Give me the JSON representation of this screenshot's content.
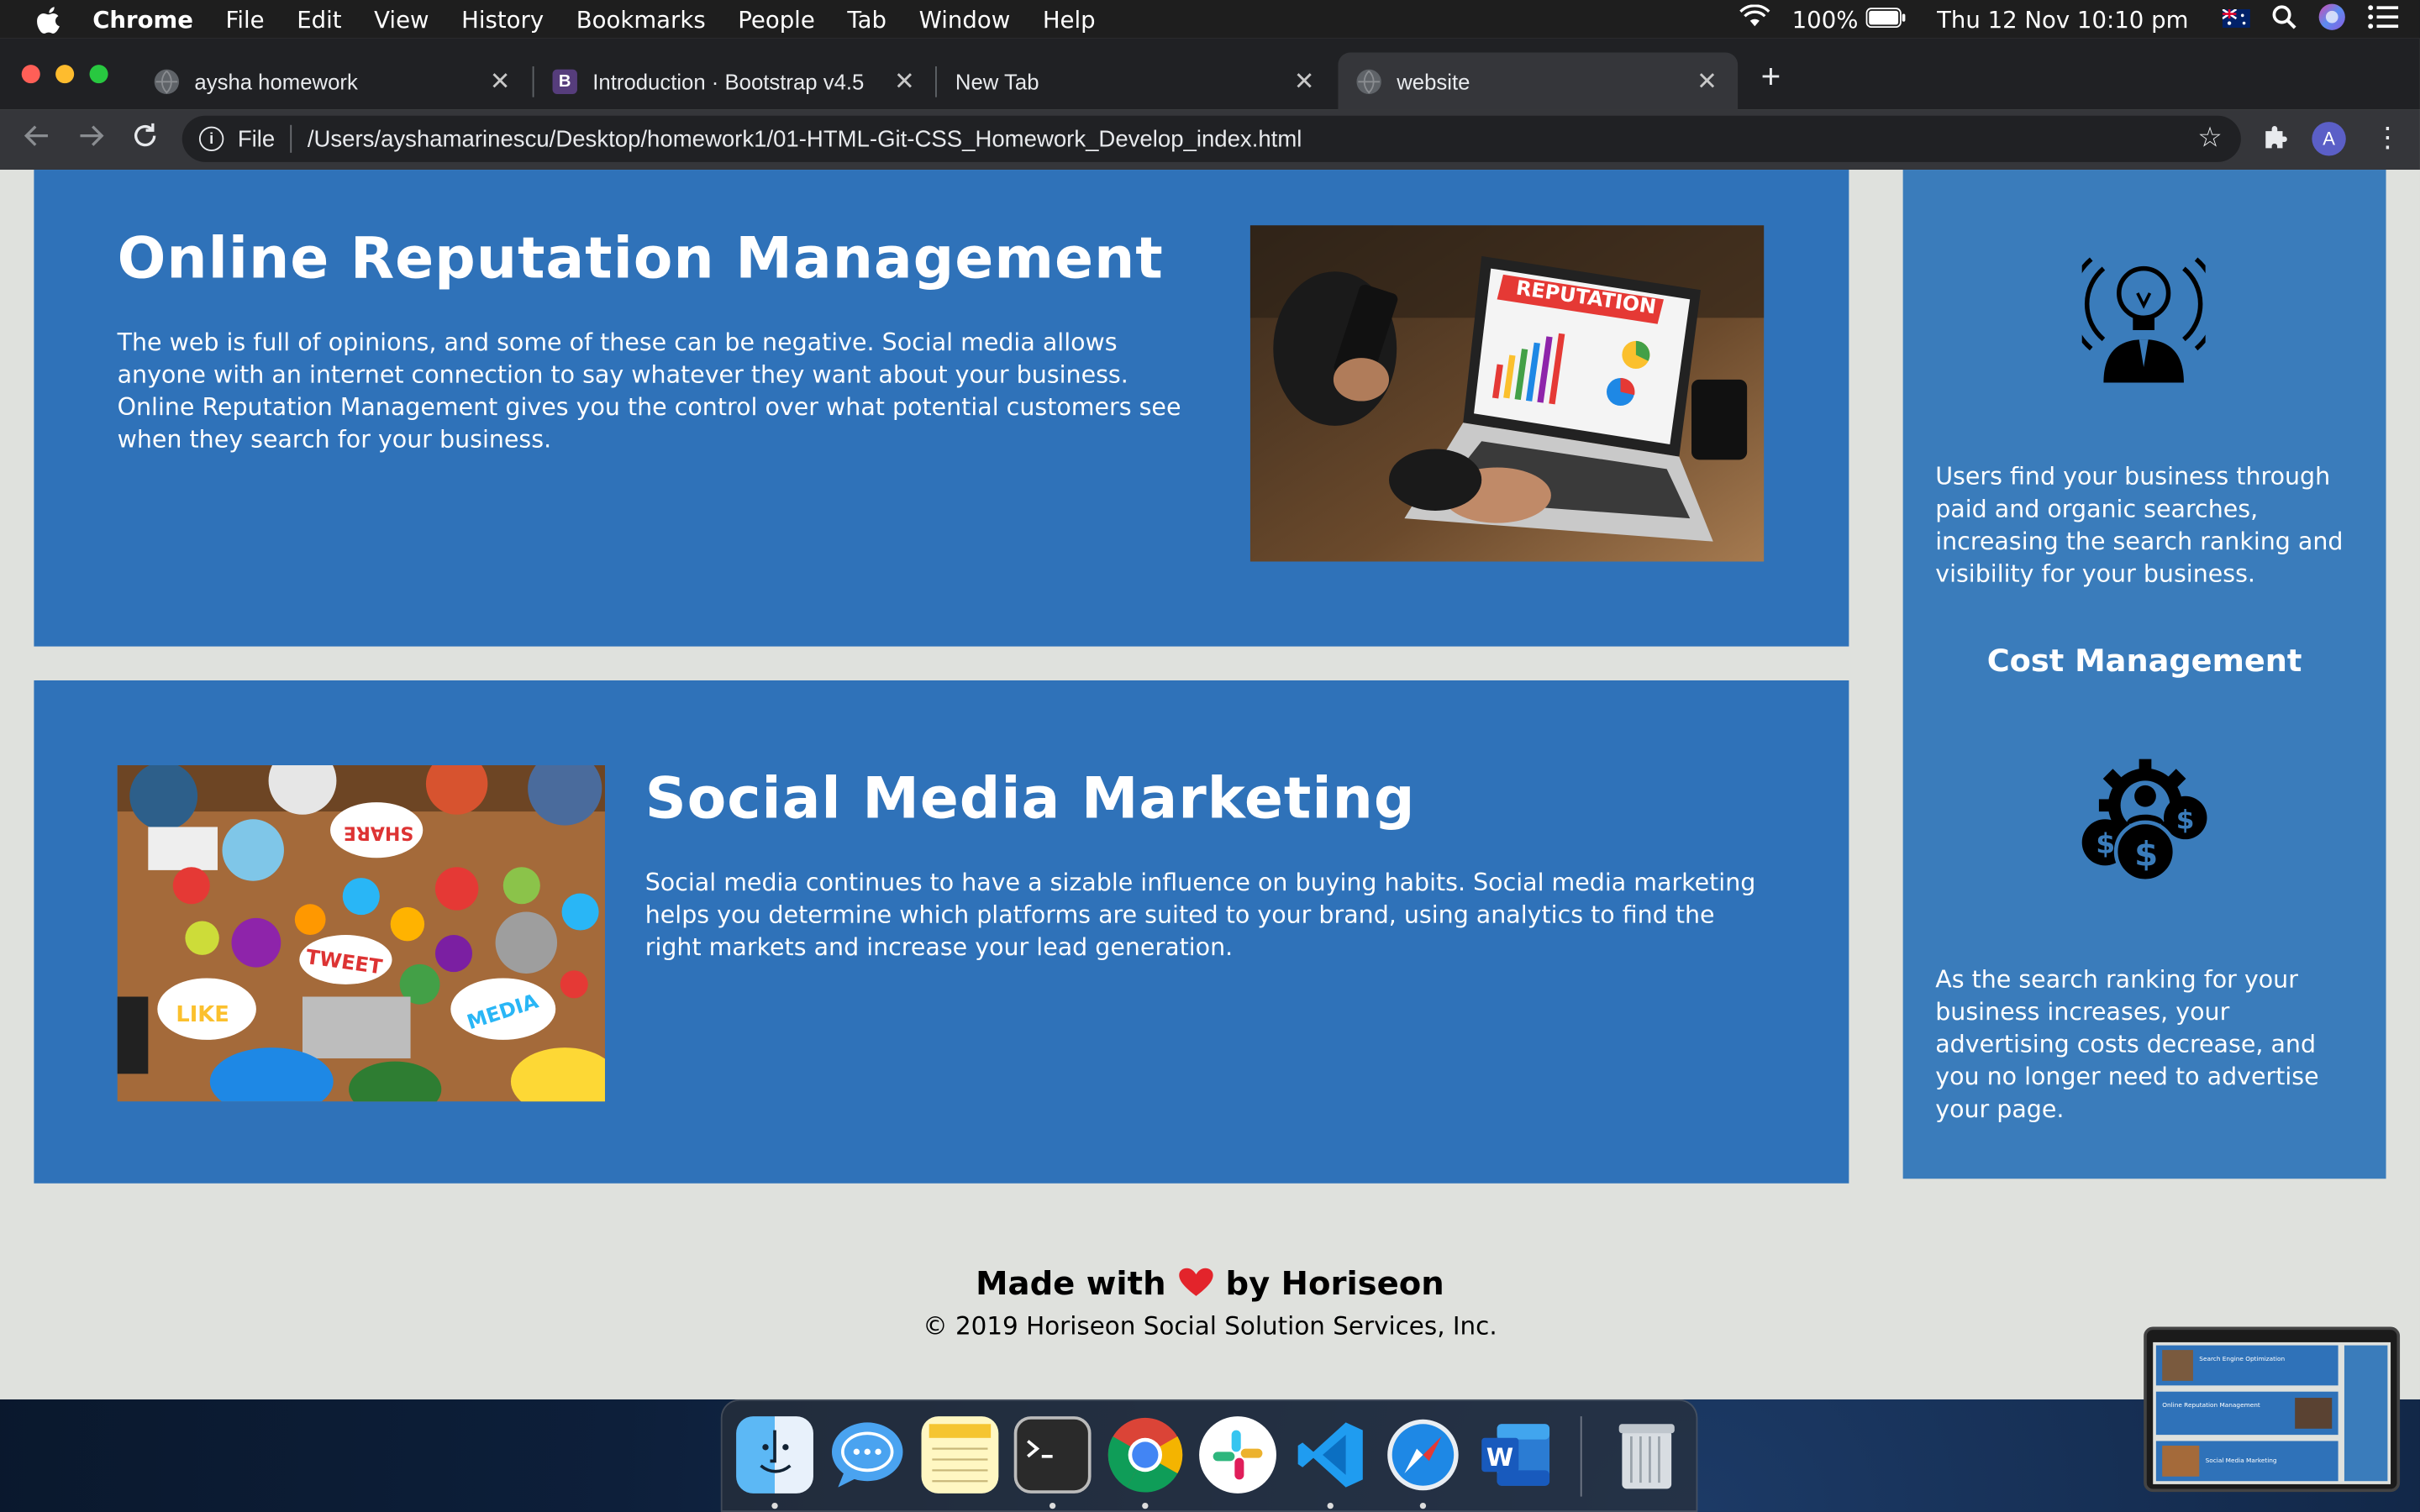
{
  "menubar": {
    "app": "Chrome",
    "items": [
      "File",
      "Edit",
      "View",
      "History",
      "Bookmarks",
      "People",
      "Tab",
      "Window",
      "Help"
    ],
    "battery": "100%",
    "datetime": "Thu 12 Nov  10:10 pm"
  },
  "tabs": [
    {
      "title": "aysha homework",
      "icon": "globe-icon"
    },
    {
      "title": "Introduction · Bootstrap v4.5",
      "icon": "bootstrap-icon",
      "icon_letter": "B"
    },
    {
      "title": "New Tab",
      "icon": ""
    },
    {
      "title": "website",
      "icon": "globe-icon",
      "active": true
    }
  ],
  "omnibox": {
    "scheme_label": "File",
    "url": "/Users/ayshamarinescu/Desktop/homework1/01-HTML-Git-CSS_Homework_Develop_index.html"
  },
  "profile_initial": "A",
  "page": {
    "orm": {
      "title": "Online Reputation Management",
      "body": "The web is full of opinions, and some of these can be negative. Social media allows anyone with an internet connection to say whatever they want about your business. Online Reputation Management gives you the control over what potential customers see when they search for your business.",
      "image_text": "REPUTATION"
    },
    "smm": {
      "title": "Social Media Marketing",
      "body": "Social media continues to have a sizable influence on buying habits. Social media marketing helps you determine which platforms are suited to your brand, using analytics to find the right markets and increase your lead generation.",
      "image_words": [
        "SHARE",
        "TWEET",
        "LIKE",
        "MEDIA"
      ]
    },
    "aside": {
      "p1": "Users find your business through paid and organic searches, increasing the search ranking and visibility for your business.",
      "h_cost": "Cost Management",
      "p2": "As the search ranking for your business increases, your advertising costs decrease, and you no longer need to advertise your page."
    },
    "footer": {
      "made_prefix": "Made with",
      "made_suffix": "by Horiseon",
      "copyright": "© 2019 Horiseon Social Solution Services, Inc."
    }
  },
  "dock": [
    "finder-icon",
    "messages-icon",
    "notes-icon",
    "terminal-icon",
    "chrome-icon",
    "slack-icon",
    "vscode-icon",
    "safari-icon",
    "word-icon",
    "trash-icon"
  ],
  "thumbnail": {
    "labels": [
      "Search Engine Optimization",
      "Online Reputation Management",
      "Social Media Marketing"
    ]
  },
  "colors": {
    "card_blue": "#2f72b9",
    "aside_blue": "#3a7cbb",
    "page_bg": "#dfe1dd",
    "heart": "#e3242b"
  }
}
